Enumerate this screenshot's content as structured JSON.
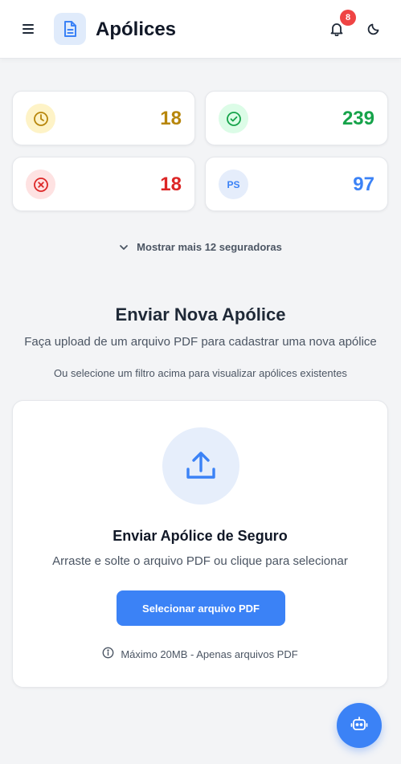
{
  "header": {
    "title": "Apólices",
    "notification_count": "8",
    "icons": {
      "menu": "hamburger-menu-icon",
      "app": "document-icon",
      "bell": "bell-icon",
      "theme": "moon-icon"
    }
  },
  "stats": [
    {
      "icon": "clock-icon",
      "value": "18",
      "color": "#b7860b",
      "bg": "#fef3c7"
    },
    {
      "icon": "check-circle-icon",
      "value": "239",
      "color": "#16a34a",
      "bg": "#dcfce7"
    },
    {
      "icon": "x-circle-icon",
      "value": "18",
      "color": "#dc2626",
      "bg": "#fee2e2"
    },
    {
      "icon": "insurer-logo",
      "label": "PS",
      "value": "97",
      "color": "#3b82f6",
      "bg": "#e5edfb"
    }
  ],
  "show_more": "Mostrar mais 12 seguradoras",
  "upload_section": {
    "title": "Enviar Nova Apólice",
    "subtitle": "Faça upload de um arquivo PDF para cadastrar uma nova apólice",
    "hint": "Ou selecione um filtro acima para visualizar apólices existentes"
  },
  "upload_card": {
    "title": "Enviar Apólice de Seguro",
    "subtitle": "Arraste e solte o arquivo PDF ou clique para selecionar",
    "button": "Selecionar arquivo PDF",
    "limit": "Máximo 20MB - Apenas arquivos PDF"
  },
  "colors": {
    "accent": "#3b82f6",
    "badge": "#ef4444",
    "background": "#f3f4f6"
  }
}
